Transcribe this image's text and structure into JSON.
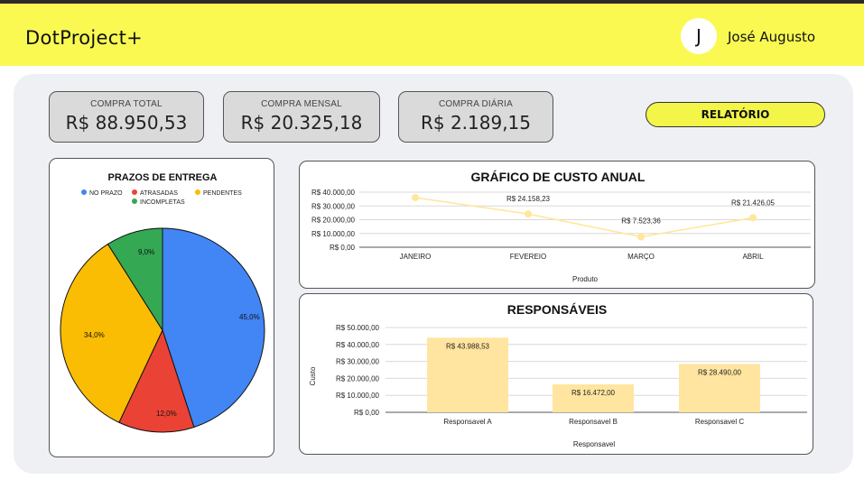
{
  "header": {
    "title": "DotProject+",
    "avatar_initial": "J",
    "user_name": "José Augusto"
  },
  "kpis": [
    {
      "label": "COMPRA TOTAL",
      "value": "R$ 88.950,53"
    },
    {
      "label": "COMPRA MENSAL",
      "value": "R$ 20.325,18"
    },
    {
      "label": "COMPRA DIÁRIA",
      "value": "R$ 2.189,15"
    }
  ],
  "report_button": "RELATÓRIO",
  "colors": {
    "header_bg": "#f9f952",
    "button_bg": "#f3f548",
    "line": "#ffe699",
    "bar": "#ffe59f",
    "blue": "#4285f4",
    "red": "#ea4335",
    "yellow": "#fbbc04",
    "green": "#34a853"
  },
  "chart_data": [
    {
      "type": "pie",
      "title": "PRAZOS DE ENTREGA",
      "legend": [
        "NO PRAZO",
        "ATRASADAS",
        "PENDENTES",
        "INCOMPLETAS"
      ],
      "legend_position": "top",
      "slices": [
        {
          "name": "NO PRAZO",
          "value": 45.0,
          "label": "45,0%",
          "color": "#4285f4"
        },
        {
          "name": "ATRASADAS",
          "value": 12.0,
          "label": "12,0%",
          "color": "#ea4335"
        },
        {
          "name": "PENDENTES",
          "value": 34.0,
          "label": "34,0%",
          "color": "#fbbc04"
        },
        {
          "name": "INCOMPLETAS",
          "value": 9.0,
          "label": "9,0%",
          "color": "#34a853"
        }
      ]
    },
    {
      "type": "line",
      "title": "GRÁFICO DE CUSTO ANUAL",
      "xlabel": "Produto",
      "categories": [
        "JANEIRO",
        "FEVEREIO",
        "MARÇO",
        "ABRIL"
      ],
      "values": [
        36000,
        24158.23,
        7523.36,
        21426.05
      ],
      "data_labels": [
        "",
        "R$ 24.158,23",
        "R$ 7.523,36",
        "R$ 21.426,05"
      ],
      "yticks": [
        0,
        10000,
        20000,
        30000,
        40000
      ],
      "ytick_labels": [
        "R$ 0,00",
        "R$ 10.000,00",
        "R$ 20.000,00",
        "R$ 30.000,00",
        "R$ 40.000,00"
      ],
      "ylim": [
        0,
        40000
      ],
      "grid": true
    },
    {
      "type": "bar",
      "title": "RESPONSÁVEIS",
      "xlabel": "Responsavel",
      "ylabel": "Custo",
      "categories": [
        "Responsavel A",
        "Responsavel B",
        "Responsavel C"
      ],
      "values": [
        43988.53,
        16472.0,
        28490.0
      ],
      "data_labels": [
        "R$ 43.988,53",
        "R$ 16.472,00",
        "R$ 28.490,00"
      ],
      "yticks": [
        0,
        10000,
        20000,
        30000,
        40000,
        50000
      ],
      "ytick_labels": [
        "R$ 0,00",
        "R$ 10.000,00",
        "R$ 20.000,00",
        "R$ 30.000,00",
        "R$ 40.000,00",
        "R$ 50.000,00"
      ],
      "ylim": [
        0,
        50000
      ],
      "grid": true
    }
  ]
}
